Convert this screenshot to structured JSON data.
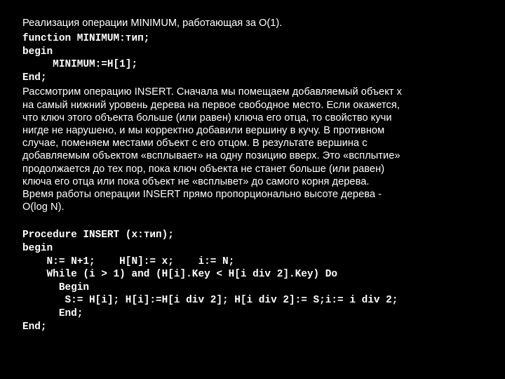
{
  "slide": {
    "background_color": "#000000",
    "text_color": "#ffffff",
    "intro": "Реализация операции MINIMUM, работающая за O(1).",
    "minimum_code": [
      "function MINIMUM:тип;",
      "begin",
      "     MINIMUM:=H[1];",
      "End;"
    ],
    "paragraph": "Рассмотрим операцию INSERT. Сначала мы помещаем добавляемый объект x\nна самый нижний уровень дерева на первое свободное место. Если окажется,\nчто ключ этого объекта больше (или равен) ключа его отца, то свойство кучи\nнигде не нарушено, и мы корректно добавили вершину в кучу. В противном\nслучае, поменяем местами объект с его отцом. В результате вершина с\nдобавляемым объектом «всплывает» на одну позицию вверх. Это «всплытие»\nпродолжается до тех пор, пока ключ объекта не станет больше (или равен)\nключа его отца или пока объект не «всплывет» до самого корня дерева.\nВремя работы операции INSERT прямо пропорционально высоте дерева -\nO(log N).",
    "insert_code": [
      "Procedure INSERT (x:тип);",
      "begin",
      "    N:= N+1;    H[N]:= x;    i:= N;",
      "    While (i > 1) and (H[i].Key < H[i div 2].Key) Do",
      "      Begin",
      "       S:= H[i]; H[i]:=H[i div 2]; H[i div 2]:= S;i:= i div 2;",
      "      End;",
      "End;"
    ]
  }
}
